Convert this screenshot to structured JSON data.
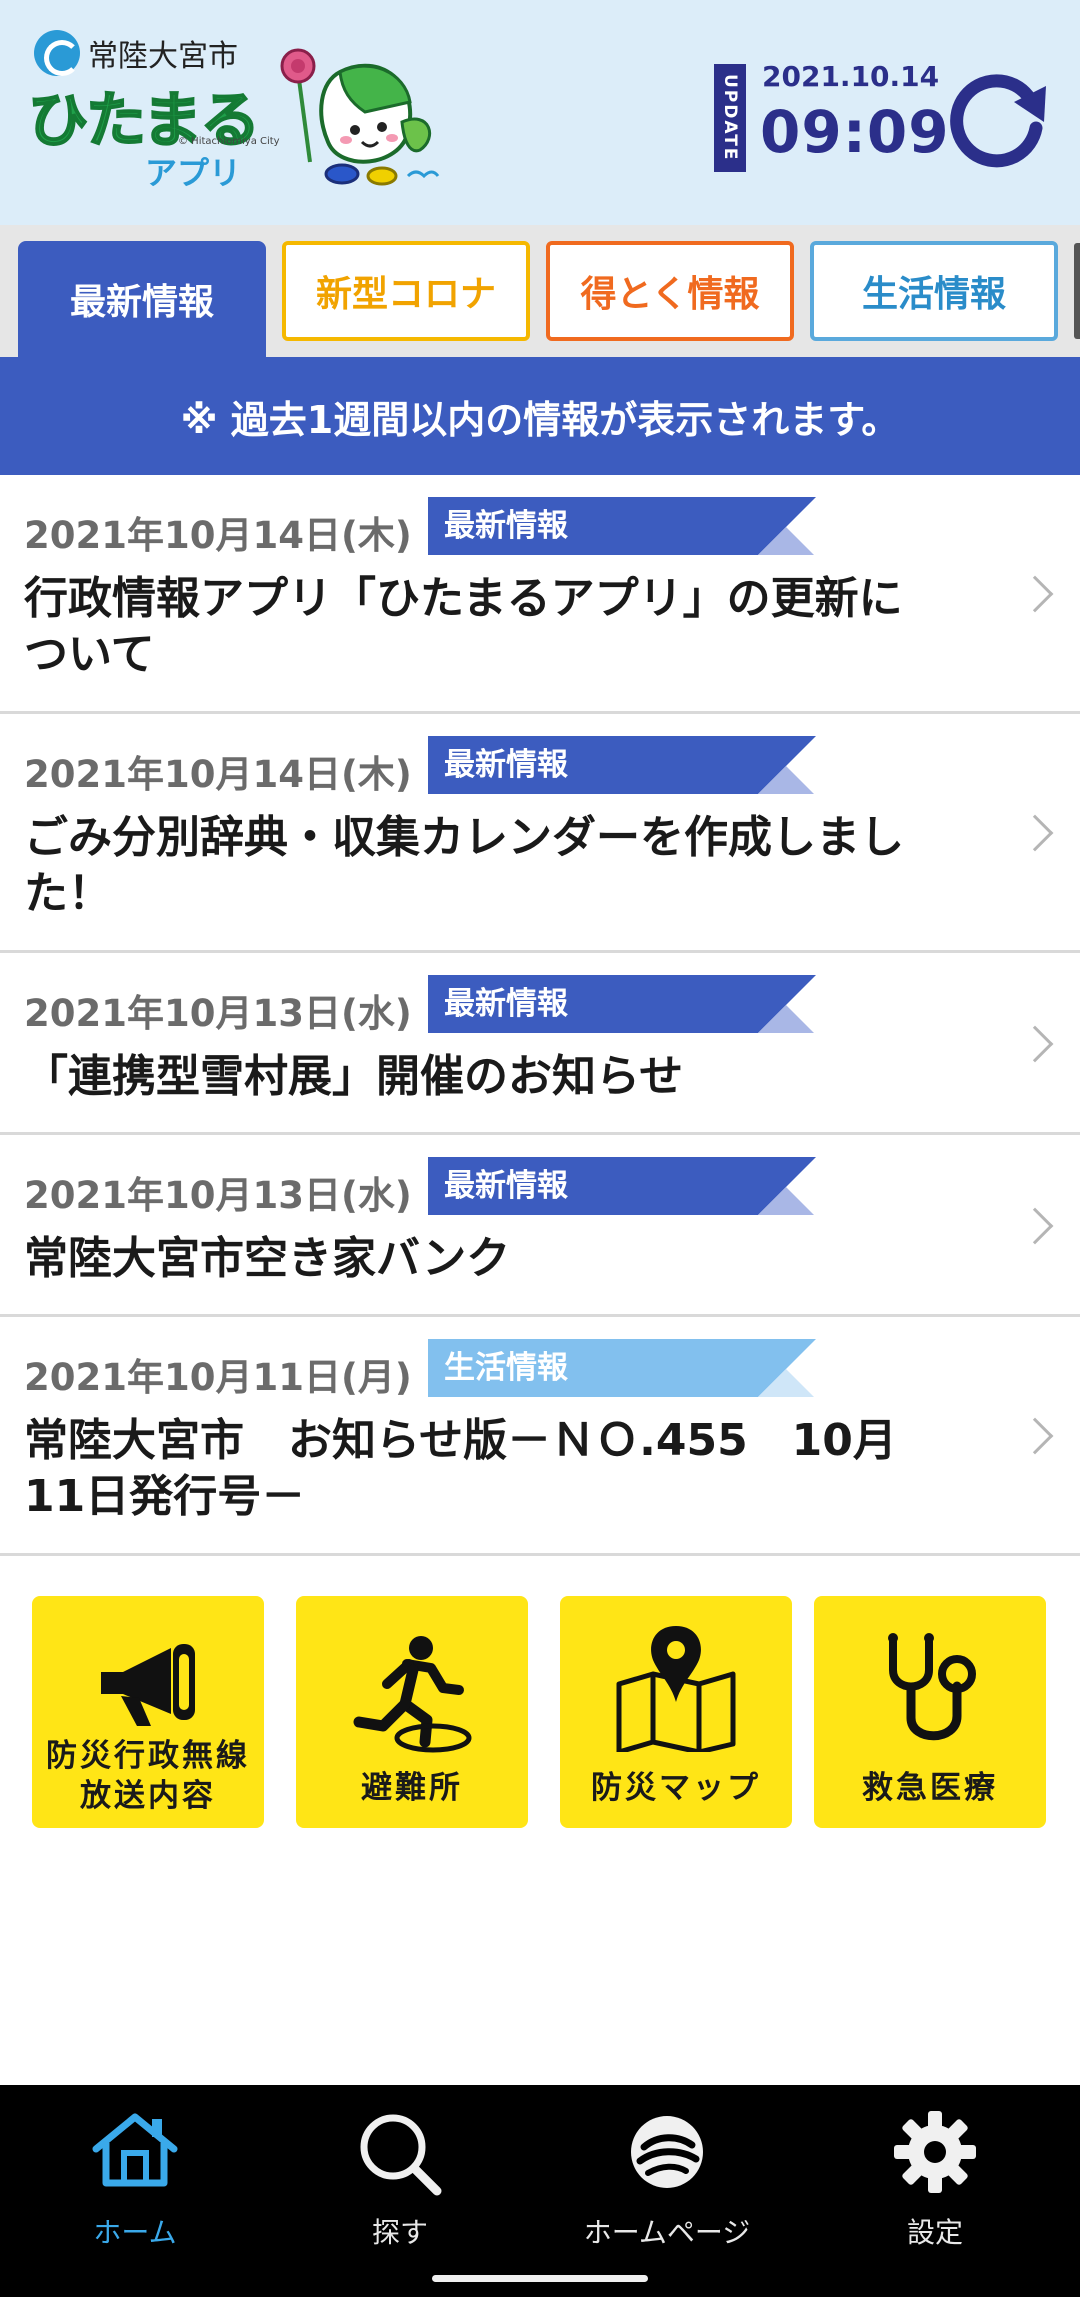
{
  "header": {
    "city_name": "常陸大宮市",
    "logo_main": "ひたまる",
    "logo_sub_en": "© Hitachiomiya City",
    "logo_app": "アプリ",
    "update_badge": "UPDATE",
    "update_date": "2021.10.14",
    "update_time": "09:09"
  },
  "tabs": [
    {
      "label": "最新情報",
      "active": true
    },
    {
      "label": "新型コロナ",
      "active": false
    },
    {
      "label": "得とく情報",
      "active": false
    },
    {
      "label": "生活情報",
      "active": false
    }
  ],
  "notice": "※ 過去1週間以内の情報が表示されます。",
  "news": [
    {
      "date": "2021年10月14日(木)",
      "tag": "最新情報",
      "title": "行政情報アプリ「ひたまるアプリ」の更新について"
    },
    {
      "date": "2021年10月14日(木)",
      "tag": "最新情報",
      "title": "ごみ分別辞典・収集カレンダーを作成しました！"
    },
    {
      "date": "2021年10月13日(水)",
      "tag": "最新情報",
      "title": "「連携型雪村展」開催のお知らせ"
    },
    {
      "date": "2021年10月13日(水)",
      "tag": "最新情報",
      "title": "常陸大宮市空き家バンク"
    },
    {
      "date": "2021年10月11日(月)",
      "tag": "生活情報",
      "title": "常陸大宮市　お知らせ版－ＮＯ.455　10月11日発行号－"
    }
  ],
  "shortcuts": [
    {
      "label_line1": "防災行政無線",
      "label_line2": "放送内容",
      "icon": "megaphone-icon"
    },
    {
      "label_line1": "避難所",
      "label_line2": "",
      "icon": "running-person-icon"
    },
    {
      "label_line1": "防災マップ",
      "label_line2": "",
      "icon": "map-pin-icon"
    },
    {
      "label_line1": "救急医療",
      "label_line2": "",
      "icon": "stethoscope-icon"
    }
  ],
  "bottom_nav": [
    {
      "label": "ホーム",
      "icon": "home-icon",
      "active": true
    },
    {
      "label": "探す",
      "icon": "search-icon",
      "active": false
    },
    {
      "label": "ホームページ",
      "icon": "city-emblem-icon",
      "active": false
    },
    {
      "label": "設定",
      "icon": "gear-icon",
      "active": false
    }
  ],
  "colors": {
    "header_bg": "#dcedf9",
    "primary_blue": "#3c5cbf",
    "navy": "#2b2f8a",
    "corona_yellow": "#f5b800",
    "toku_orange": "#f06a1f",
    "life_blue": "#5aa9dc",
    "shortcut_yellow": "#ffe516",
    "nav_active": "#3aa9ea"
  }
}
